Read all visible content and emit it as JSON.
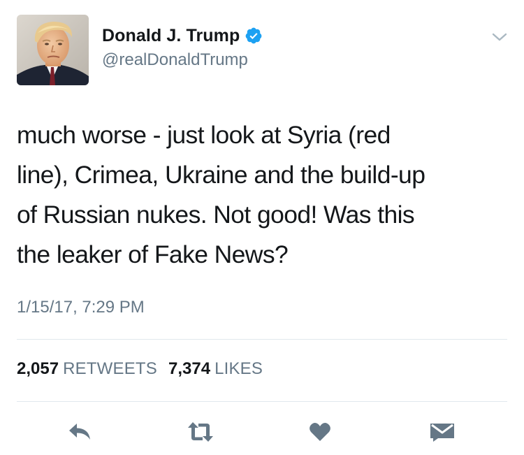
{
  "header": {
    "display_name": "Donald J. Trump",
    "handle": "@realDonaldTrump",
    "verified": true,
    "verified_color": "#1da1f2"
  },
  "tweet": {
    "text": "much worse - just look at Syria (red\nline), Crimea, Ukraine and the build-up\nof Russian nukes. Not good! Was this\nthe leaker of Fake News?",
    "timestamp": "1/15/17, 7:29 PM"
  },
  "stats": {
    "retweets_count": "2,057",
    "retweets_label": "RETWEETS",
    "likes_count": "7,374",
    "likes_label": "LIKES"
  },
  "actions": [
    {
      "icon": "reply-icon"
    },
    {
      "icon": "retweet-icon"
    },
    {
      "icon": "heart-icon"
    },
    {
      "icon": "direct-message-icon"
    }
  ],
  "colors": {
    "text": "#14171a",
    "secondary": "#657786",
    "divider": "#e1e8ed",
    "action_icon": "#657786"
  }
}
